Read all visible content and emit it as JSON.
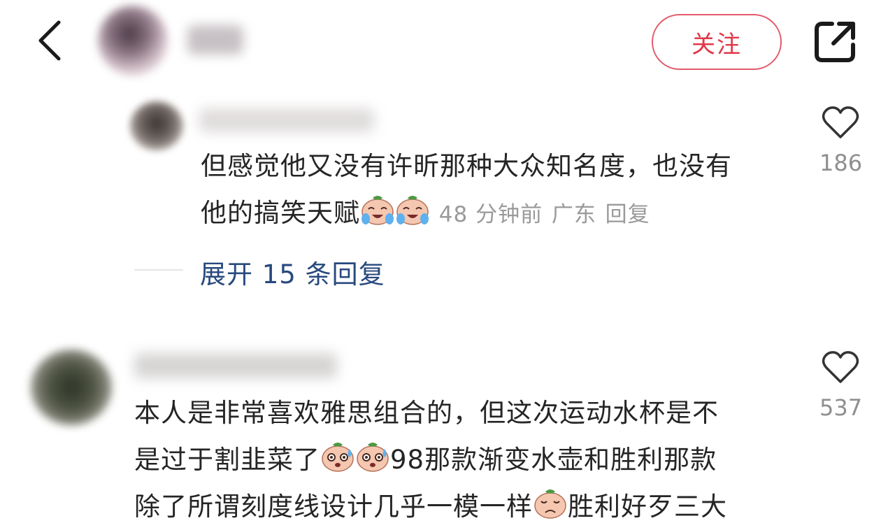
{
  "header": {
    "follow_label": "关注",
    "icons": {
      "back": "chevron-left-icon",
      "share": "share-external-icon"
    }
  },
  "reply_comment": {
    "text_line1": "但感觉他又没有许昕那种大众知名度，也没有",
    "text_line2": "他的搞笑天赋",
    "emojis": [
      "crying-laugh-emoji",
      "crying-laugh-emoji"
    ],
    "time": "48 分钟前",
    "location": "广东",
    "reply_label": "回复",
    "likes": "186"
  },
  "expand": {
    "label": "展开 15 条回复"
  },
  "comment2": {
    "line1": "本人是非常喜欢雅思组合的，但这次运动水杯是不",
    "line2_a": "是过于割韭菜了",
    "line2_emojis": [
      "sweating-emoji",
      "sweating-emoji"
    ],
    "line2_b": "98那款渐变水壶和胜利那款",
    "line3_a": "除了所谓刻度线设计几乎一模一样",
    "line3_emoji": "sad-emoji",
    "line3_b": "胜利好歹三大",
    "likes": "537"
  },
  "colors": {
    "accent_red": "#e03848",
    "link_blue": "#27497d",
    "meta_gray": "#9a9a9a"
  }
}
